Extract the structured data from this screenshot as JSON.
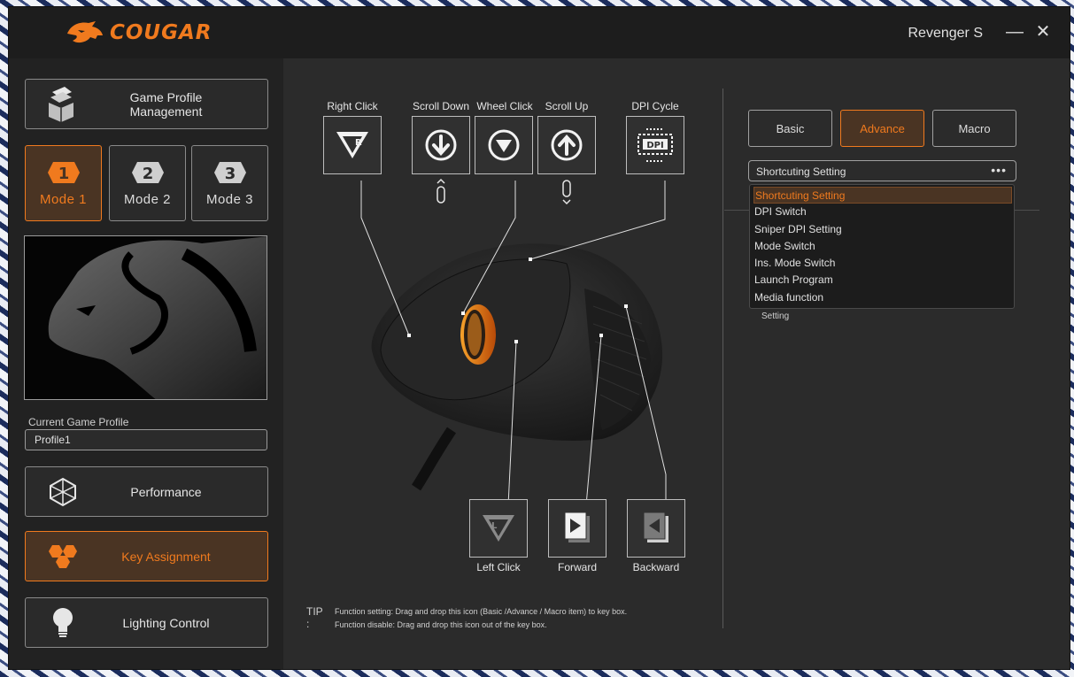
{
  "app": {
    "logo_text": "COUGAR",
    "device_name": "Revenger S",
    "minimize_glyph": "—",
    "close_glyph": "✕"
  },
  "sidebar": {
    "game_profile_label_line1": "Game Profile",
    "game_profile_label_line2": "Management",
    "modes": [
      {
        "number": "1",
        "label": "Mode 1",
        "active": true
      },
      {
        "number": "2",
        "label": "Mode 2",
        "active": false
      },
      {
        "number": "3",
        "label": "Mode 3",
        "active": false
      }
    ],
    "current_profile_label": "Current Game Profile",
    "current_profile_value": "Profile1",
    "nav": {
      "performance": "Performance",
      "key_assignment": "Key Assignment",
      "lighting_control": "Lighting Control"
    }
  },
  "keys": {
    "right_click": "Right Click",
    "scroll_down": "Scroll Down",
    "wheel_click": "Wheel Click",
    "scroll_up": "Scroll Up",
    "dpi_cycle": "DPI Cycle",
    "dpi_icon_text": "DPI",
    "left_click": "Left Click",
    "forward": "Forward",
    "backward": "Backward"
  },
  "tip": {
    "head": "TIP :",
    "line1": "Function setting: Drag and drop this icon (Basic /Advance / Macro item) to key box.",
    "line2": "Function disable: Drag and drop this icon out of the key box."
  },
  "right_panel": {
    "tabs": [
      {
        "label": "Basic",
        "active": false
      },
      {
        "label": "Advance",
        "active": true
      },
      {
        "label": "Macro",
        "active": false
      }
    ],
    "dropdown_value": "Shortcuting Setting",
    "dropdown_dots": "•••",
    "dropdown_options": [
      "Shortcuting Setting",
      "DPI Switch",
      "Sniper DPI Setting",
      "Mode Switch",
      "Ins. Mode Switch",
      "Launch Program",
      "Media function"
    ],
    "partial_label": "Setting"
  },
  "colors": {
    "accent": "#f07a1e",
    "window_bg": "#2b2b2b",
    "sidebar_bg": "#222222"
  }
}
